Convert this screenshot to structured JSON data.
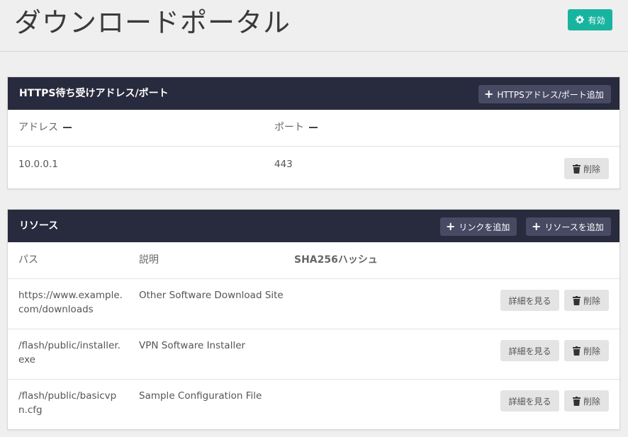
{
  "header": {
    "title": "ダウンロードポータル",
    "enable_label": "有効"
  },
  "https_panel": {
    "title": "HTTPS待ち受けアドレス/ポート",
    "add_button": "HTTPSアドレス/ポート追加",
    "columns": {
      "address": "アドレス",
      "port": "ポート"
    },
    "rows": [
      {
        "address": "10.0.0.1",
        "port": "443",
        "delete_label": "削除"
      }
    ]
  },
  "resources_panel": {
    "title": "リソース",
    "add_link_button": "リンクを追加",
    "add_resource_button": "リソースを追加",
    "columns": {
      "path": "パス",
      "description": "説明",
      "hash": "SHA256ハッシュ"
    },
    "rows": [
      {
        "path_line1": "https://www.example.",
        "path_line2": "com/downloads",
        "description": "Other Software Download Site",
        "details_label": "詳細を見る",
        "delete_label": "削除"
      },
      {
        "path_line1": "/flash/public/installer.",
        "path_line2": "exe",
        "description": "VPN Software Installer",
        "details_label": "詳細を見る",
        "delete_label": "削除"
      },
      {
        "path_line1": "/flash/public/basicvp",
        "path_line2": "n.cfg",
        "description": "Sample Configuration File",
        "details_label": "詳細を見る",
        "delete_label": "削除"
      }
    ]
  },
  "colors": {
    "header_bar": "#282a3d",
    "header_button": "#484a63",
    "enable_button": "#19b4a0",
    "secondary_button": "#e4e4e4"
  },
  "icons": {
    "enable": "gear-icon",
    "add": "plus-icon",
    "delete": "trash-icon",
    "sort": "sort-icon"
  }
}
